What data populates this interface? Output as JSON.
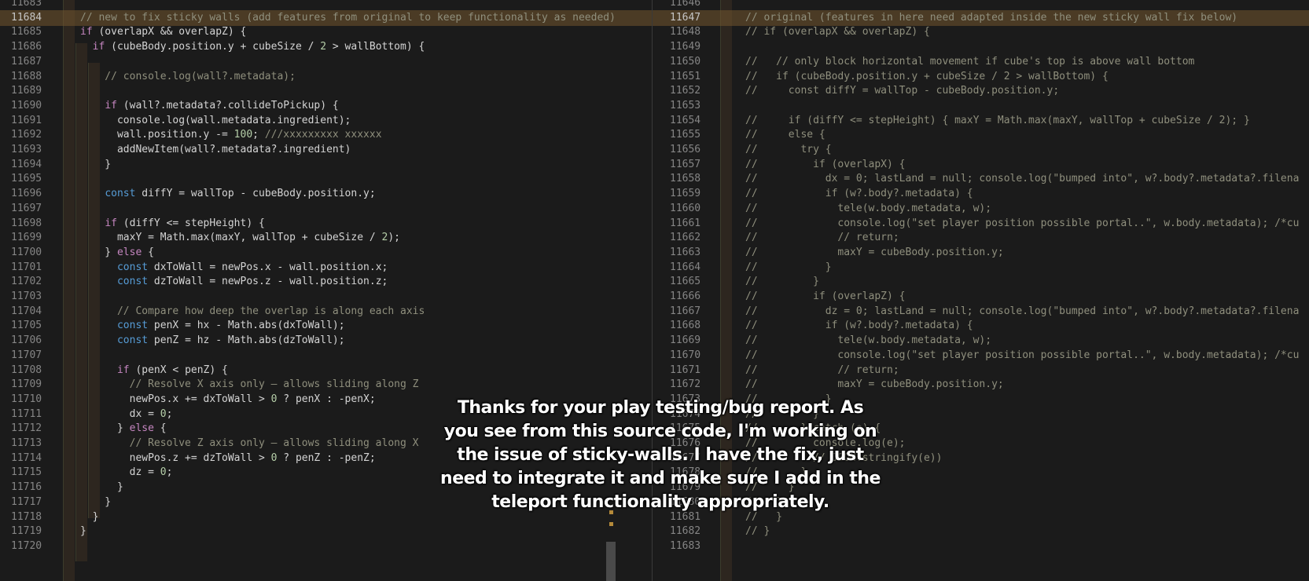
{
  "left_editor": {
    "rows": [
      {
        "ln": "11683",
        "code": "",
        "hl": false
      },
      {
        "ln": "11684",
        "code": "// new to fix sticky walls (add features from original to keep functionality as needed)",
        "hl": true,
        "active": true
      },
      {
        "ln": "11685",
        "code": "if (overlapX && overlapZ) {",
        "hl": false
      },
      {
        "ln": "11686",
        "code": "  if (cubeBody.position.y + cubeSize / 2 > wallBottom) {",
        "hl": false
      },
      {
        "ln": "11687",
        "code": "",
        "hl": false
      },
      {
        "ln": "11688",
        "code": "    // console.log(wall?.metadata);",
        "hl": false
      },
      {
        "ln": "11689",
        "code": "",
        "hl": false
      },
      {
        "ln": "11690",
        "code": "    if (wall?.metadata?.collideToPickup) {",
        "hl": false
      },
      {
        "ln": "11691",
        "code": "      console.log(wall.metadata.ingredient);",
        "hl": false
      },
      {
        "ln": "11692",
        "code": "      wall.position.y -= 100; ///xxxxxxxxx xxxxxx",
        "hl": false
      },
      {
        "ln": "11693",
        "code": "      addNewItem(wall?.metadata?.ingredient)",
        "hl": false
      },
      {
        "ln": "11694",
        "code": "    }",
        "hl": false
      },
      {
        "ln": "11695",
        "code": "",
        "hl": false
      },
      {
        "ln": "11696",
        "code": "    const diffY = wallTop - cubeBody.position.y;",
        "hl": false
      },
      {
        "ln": "11697",
        "code": "",
        "hl": false
      },
      {
        "ln": "11698",
        "code": "    if (diffY <= stepHeight) {",
        "hl": false
      },
      {
        "ln": "11699",
        "code": "      maxY = Math.max(maxY, wallTop + cubeSize / 2);",
        "hl": false
      },
      {
        "ln": "11700",
        "code": "    } else {",
        "hl": false
      },
      {
        "ln": "11701",
        "code": "      const dxToWall = newPos.x - wall.position.x;",
        "hl": false
      },
      {
        "ln": "11702",
        "code": "      const dzToWall = newPos.z - wall.position.z;",
        "hl": false
      },
      {
        "ln": "11703",
        "code": "",
        "hl": false
      },
      {
        "ln": "11704",
        "code": "      // Compare how deep the overlap is along each axis",
        "hl": false
      },
      {
        "ln": "11705",
        "code": "      const penX = hx - Math.abs(dxToWall);",
        "hl": false
      },
      {
        "ln": "11706",
        "code": "      const penZ = hz - Math.abs(dzToWall);",
        "hl": false
      },
      {
        "ln": "11707",
        "code": "",
        "hl": false
      },
      {
        "ln": "11708",
        "code": "      if (penX < penZ) {",
        "hl": false
      },
      {
        "ln": "11709",
        "code": "        // Resolve X axis only — allows sliding along Z",
        "hl": false
      },
      {
        "ln": "11710",
        "code": "        newPos.x += dxToWall > 0 ? penX : -penX;",
        "hl": false
      },
      {
        "ln": "11711",
        "code": "        dx = 0;",
        "hl": false
      },
      {
        "ln": "11712",
        "code": "      } else {",
        "hl": false
      },
      {
        "ln": "11713",
        "code": "        // Resolve Z axis only — allows sliding along X",
        "hl": false
      },
      {
        "ln": "11714",
        "code": "        newPos.z += dzToWall > 0 ? penZ : -penZ;",
        "hl": false
      },
      {
        "ln": "11715",
        "code": "        dz = 0;",
        "hl": false
      },
      {
        "ln": "11716",
        "code": "      }",
        "hl": false
      },
      {
        "ln": "11717",
        "code": "    }",
        "hl": false
      },
      {
        "ln": "11718",
        "code": "  }",
        "hl": false
      },
      {
        "ln": "11719",
        "code": "}",
        "hl": false
      },
      {
        "ln": "11720",
        "code": "",
        "hl": false
      }
    ]
  },
  "right_editor": {
    "rows": [
      {
        "ln": "11646",
        "code": "",
        "hl": false
      },
      {
        "ln": "11647",
        "code": "// original (features in here need adapted inside the new sticky wall fix below)",
        "hl": true,
        "active": true
      },
      {
        "ln": "11648",
        "code": "// if (overlapX && overlapZ) {",
        "hl": false
      },
      {
        "ln": "11649",
        "code": "",
        "hl": false
      },
      {
        "ln": "11650",
        "code": "//   // only block horizontal movement if cube's top is above wall bottom",
        "hl": false
      },
      {
        "ln": "11651",
        "code": "//   if (cubeBody.position.y + cubeSize / 2 > wallBottom) {",
        "hl": false
      },
      {
        "ln": "11652",
        "code": "//     const diffY = wallTop - cubeBody.position.y;",
        "hl": false
      },
      {
        "ln": "11653",
        "code": "",
        "hl": false
      },
      {
        "ln": "11654",
        "code": "//     if (diffY <= stepHeight) { maxY = Math.max(maxY, wallTop + cubeSize / 2); }",
        "hl": false
      },
      {
        "ln": "11655",
        "code": "//     else {",
        "hl": false
      },
      {
        "ln": "11656",
        "code": "//       try {",
        "hl": false
      },
      {
        "ln": "11657",
        "code": "//         if (overlapX) {",
        "hl": false
      },
      {
        "ln": "11658",
        "code": "//           dx = 0; lastLand = null; console.log(\"bumped into\", w?.body?.metadata?.filena",
        "hl": false
      },
      {
        "ln": "11659",
        "code": "//           if (w?.body?.metadata) {",
        "hl": false
      },
      {
        "ln": "11660",
        "code": "//             tele(w.body.metadata, w);",
        "hl": false
      },
      {
        "ln": "11661",
        "code": "//             console.log(\"set player position possible portal..\", w.body.metadata); /*cu",
        "hl": false
      },
      {
        "ln": "11662",
        "code": "//             // return;",
        "hl": false
      },
      {
        "ln": "11663",
        "code": "//             maxY = cubeBody.position.y;",
        "hl": false
      },
      {
        "ln": "11664",
        "code": "//           }",
        "hl": false
      },
      {
        "ln": "11665",
        "code": "//         }",
        "hl": false
      },
      {
        "ln": "11666",
        "code": "//         if (overlapZ) {",
        "hl": false
      },
      {
        "ln": "11667",
        "code": "//           dz = 0; lastLand = null; console.log(\"bumped into\", w?.body?.metadata?.filena",
        "hl": false
      },
      {
        "ln": "11668",
        "code": "//           if (w?.body?.metadata) {",
        "hl": false
      },
      {
        "ln": "11669",
        "code": "//             tele(w.body.metadata, w);",
        "hl": false
      },
      {
        "ln": "11670",
        "code": "//             console.log(\"set player position possible portal..\", w.body.metadata); /*cu",
        "hl": false
      },
      {
        "ln": "11671",
        "code": "//             // return;",
        "hl": false
      },
      {
        "ln": "11672",
        "code": "//             maxY = cubeBody.position.y;",
        "hl": false
      },
      {
        "ln": "11673",
        "code": "//           }",
        "hl": false
      },
      {
        "ln": "11674",
        "code": "//         }",
        "hl": false
      },
      {
        "ln": "11675",
        "code": "//       } catch (e) {",
        "hl": false
      },
      {
        "ln": "11676",
        "code": "//         console.log(e);",
        "hl": false
      },
      {
        "ln": "11677",
        "code": "//         // JSON.stringify(e))",
        "hl": false
      },
      {
        "ln": "11678",
        "code": "//       }",
        "hl": false
      },
      {
        "ln": "11679",
        "code": "//     }",
        "hl": false
      },
      {
        "ln": "11680",
        "code": "//   }",
        "hl": false
      },
      {
        "ln": "11681",
        "code": "//   }",
        "hl": false
      },
      {
        "ln": "11682",
        "code": "// }",
        "hl": false
      },
      {
        "ln": "11683",
        "code": "",
        "hl": false
      }
    ]
  },
  "caption": {
    "text": "Thanks for your play testing/bug report.  As you see from this source code, I'm working on the issue of sticky-walls.  I have the fix, just need to integrate it and make sure I add in the teleport functionality appropriately."
  },
  "colors": {
    "background": "#1b1b1b",
    "highlight_row": "#6b5230",
    "comment": "#8f8f7d",
    "identifier": "#ef5b5b",
    "keyword": "#c586c0"
  }
}
